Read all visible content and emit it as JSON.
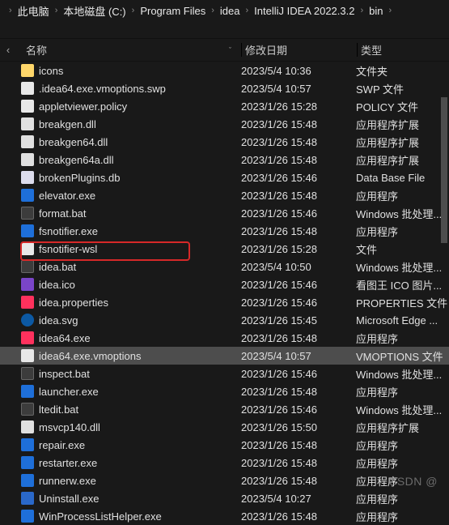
{
  "breadcrumbs": [
    "此电脑",
    "本地磁盘 (C:)",
    "Program Files",
    "idea",
    "IntelliJ IDEA 2022.3.2",
    "bin"
  ],
  "columns": {
    "name": "名称",
    "date": "修改日期",
    "type": "类型"
  },
  "files": [
    {
      "name": "icons",
      "date": "2023/5/4 10:36",
      "type": "文件夹",
      "icon": "ico-folder"
    },
    {
      "name": ".idea64.exe.vmoptions.swp",
      "date": "2023/5/4 10:57",
      "type": "SWP 文件",
      "icon": "ico-generic"
    },
    {
      "name": "appletviewer.policy",
      "date": "2023/1/26 15:28",
      "type": "POLICY 文件",
      "icon": "ico-generic"
    },
    {
      "name": "breakgen.dll",
      "date": "2023/1/26 15:48",
      "type": "应用程序扩展",
      "icon": "ico-dll"
    },
    {
      "name": "breakgen64.dll",
      "date": "2023/1/26 15:48",
      "type": "应用程序扩展",
      "icon": "ico-dll"
    },
    {
      "name": "breakgen64a.dll",
      "date": "2023/1/26 15:48",
      "type": "应用程序扩展",
      "icon": "ico-dll"
    },
    {
      "name": "brokenPlugins.db",
      "date": "2023/1/26 15:46",
      "type": "Data Base File",
      "icon": "ico-db"
    },
    {
      "name": "elevator.exe",
      "date": "2023/1/26 15:48",
      "type": "应用程序",
      "icon": "ico-exe"
    },
    {
      "name": "format.bat",
      "date": "2023/1/26 15:46",
      "type": "Windows 批处理...",
      "icon": "ico-bat"
    },
    {
      "name": "fsnotifier.exe",
      "date": "2023/1/26 15:48",
      "type": "应用程序",
      "icon": "ico-exe"
    },
    {
      "name": "fsnotifier-wsl",
      "date": "2023/1/26 15:28",
      "type": "文件",
      "icon": "ico-generic"
    },
    {
      "name": "idea.bat",
      "date": "2023/5/4 10:50",
      "type": "Windows 批处理...",
      "icon": "ico-bat",
      "highlighted": true
    },
    {
      "name": "idea.ico",
      "date": "2023/1/26 15:46",
      "type": "看图王 ICO 图片...",
      "icon": "ico-pic"
    },
    {
      "name": "idea.properties",
      "date": "2023/1/26 15:46",
      "type": "PROPERTIES 文件",
      "icon": "ico-ij"
    },
    {
      "name": "idea.svg",
      "date": "2023/1/26 15:45",
      "type": "Microsoft Edge ...",
      "icon": "ico-edge"
    },
    {
      "name": "idea64.exe",
      "date": "2023/1/26 15:48",
      "type": "应用程序",
      "icon": "ico-ij"
    },
    {
      "name": "idea64.exe.vmoptions",
      "date": "2023/5/4 10:57",
      "type": "VMOPTIONS 文件",
      "icon": "ico-generic",
      "selected": true
    },
    {
      "name": "inspect.bat",
      "date": "2023/1/26 15:46",
      "type": "Windows 批处理...",
      "icon": "ico-bat"
    },
    {
      "name": "launcher.exe",
      "date": "2023/1/26 15:48",
      "type": "应用程序",
      "icon": "ico-exe"
    },
    {
      "name": "ltedit.bat",
      "date": "2023/1/26 15:46",
      "type": "Windows 批处理...",
      "icon": "ico-bat"
    },
    {
      "name": "msvcp140.dll",
      "date": "2023/1/26 15:50",
      "type": "应用程序扩展",
      "icon": "ico-dll"
    },
    {
      "name": "repair.exe",
      "date": "2023/1/26 15:48",
      "type": "应用程序",
      "icon": "ico-exe"
    },
    {
      "name": "restarter.exe",
      "date": "2023/1/26 15:48",
      "type": "应用程序",
      "icon": "ico-exe"
    },
    {
      "name": "runnerw.exe",
      "date": "2023/1/26 15:48",
      "type": "应用程序",
      "icon": "ico-exe"
    },
    {
      "name": "Uninstall.exe",
      "date": "2023/5/4 10:27",
      "type": "应用程序",
      "icon": "ico-uninst"
    },
    {
      "name": "WinProcessListHelper.exe",
      "date": "2023/1/26 15:48",
      "type": "应用程序",
      "icon": "ico-exe"
    }
  ],
  "watermark": "CSDN @"
}
